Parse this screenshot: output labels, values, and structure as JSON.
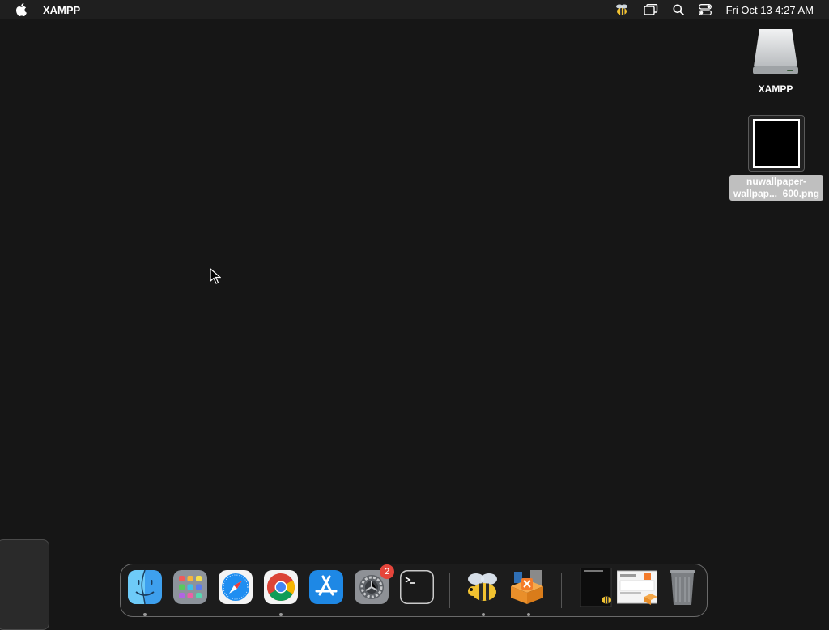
{
  "menubar": {
    "app_name": "XAMPP",
    "clock": "Fri Oct 13  4:27 AM",
    "icons": [
      "apple-logo",
      "bee-status-icon",
      "screen-mirroring-icon",
      "spotlight-search-icon",
      "control-center-icon"
    ]
  },
  "desktop": {
    "drive": {
      "label": "XAMPP",
      "icon": "external-drive-icon"
    },
    "file": {
      "label_line1": "nuwallpaper-",
      "label_line2": "wallpap..._600.png",
      "icon": "image-file-icon"
    }
  },
  "dock": {
    "apps": [
      {
        "name": "Finder",
        "icon": "finder-icon",
        "running": true
      },
      {
        "name": "Launchpad",
        "icon": "launchpad-icon",
        "running": false
      },
      {
        "name": "Safari",
        "icon": "safari-icon",
        "running": false
      },
      {
        "name": "Google Chrome",
        "icon": "chrome-icon",
        "running": true
      },
      {
        "name": "App Store",
        "icon": "app-store-icon",
        "running": false
      },
      {
        "name": "System Settings",
        "icon": "system-settings-icon",
        "running": false,
        "badge": "2"
      },
      {
        "name": "Terminal",
        "icon": "terminal-icon",
        "running": false
      },
      {
        "name": "Bee app",
        "icon": "bee-icon",
        "running": true
      },
      {
        "name": "XAMPP manager",
        "icon": "xampp-icon",
        "running": true
      },
      {
        "name": "Recent window 1",
        "icon": "window-thumbnail-icon",
        "running": false
      },
      {
        "name": "Recent window 2",
        "icon": "window-thumbnail-icon",
        "running": false
      },
      {
        "name": "Trash",
        "icon": "trash-icon",
        "running": false
      }
    ]
  },
  "colors": {
    "desktop_bg": "#161616",
    "menubar_bg": "#1f1f1f",
    "badge": "#e5453b",
    "accent_blue": "#1e88e5"
  }
}
